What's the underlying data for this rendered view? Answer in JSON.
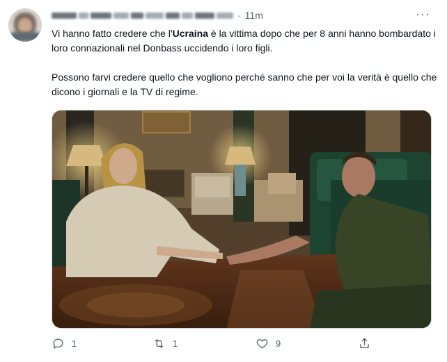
{
  "tweet": {
    "time": "11m",
    "separator": "·",
    "more_label": "···",
    "text": {
      "line1_pre": "Vi hanno fatto credere che l'",
      "line1_bold": "Ucraina",
      "line1_post": " è la vittima dopo che per 8 anni hanno bombardato i loro connazionali nel Donbass uccidendo i loro figli.",
      "paragraph2": "Possono farvi credere quello che vogliono perché sanno che per voi la verità è quello che dicono i giornali e  la TV di regime."
    },
    "actions": {
      "reply_count": "1",
      "retweet_count": "1",
      "like_count": "9"
    }
  },
  "icons": {
    "reply": "reply-icon",
    "retweet": "retweet-icon",
    "like": "heart-icon",
    "share": "share-icon",
    "more": "more-icon"
  },
  "colors": {
    "text": "#0f1419",
    "muted": "#536471",
    "border": "#cfd9de"
  }
}
